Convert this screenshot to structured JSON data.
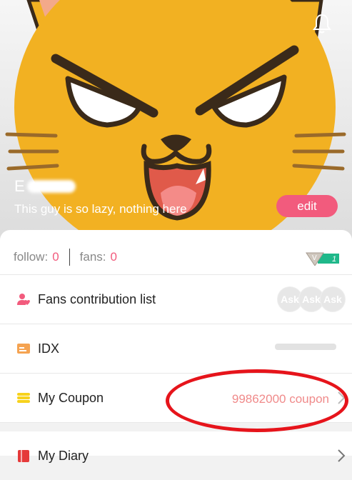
{
  "header": {
    "username": "E",
    "bio": "This guy is so lazy, nothing here",
    "edit_label": "edit"
  },
  "stats": {
    "follow_label": "follow:",
    "follow_count": "0",
    "fans_label": "fans:",
    "fans_count": "0",
    "vip_badge_letter": "V",
    "vip_level": "1"
  },
  "menu": {
    "fans_contribution": {
      "label": "Fans contribution list",
      "avatars": [
        "Ask",
        "Ask",
        "Ask"
      ]
    },
    "idx": {
      "label": "IDX"
    },
    "coupon": {
      "label": "My Coupon",
      "value": "99862000 coupon"
    },
    "diary": {
      "label": "My Diary"
    }
  },
  "colors": {
    "accent": "#f25b7d",
    "coupon_value": "#f08a8a",
    "highlight": "#e6141b",
    "cat_fur": "#f2b122"
  },
  "icons": [
    "bell-icon",
    "user-heart-icon",
    "id-card-icon",
    "coupon-icon",
    "diary-icon",
    "chevron-right-icon",
    "vip-diamond-icon"
  ]
}
